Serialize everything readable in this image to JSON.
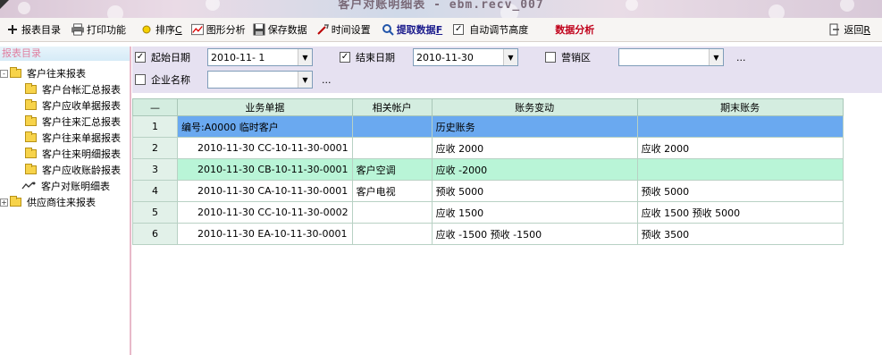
{
  "window": {
    "title": "客户对账明细表 - ebm.recv_007"
  },
  "toolbar": {
    "items": [
      {
        "label": "报表目录",
        "icon": "plus-icon"
      },
      {
        "label": "打印功能",
        "icon": "printer-icon"
      },
      {
        "label": "排序",
        "hotkey": "C",
        "icon": "sort-icon"
      },
      {
        "label": "图形分析",
        "icon": "chart-icon"
      },
      {
        "label": "保存数据",
        "icon": "save-icon"
      },
      {
        "label": "时间设置",
        "icon": "clock-icon"
      },
      {
        "label": "提取数据",
        "hotkey": "F",
        "icon": "fetch-icon"
      },
      {
        "label": "自动调节高度",
        "checked": true
      },
      {
        "label": "数据分析"
      },
      {
        "label": "返回",
        "hotkey": "R",
        "icon": "return-icon"
      }
    ]
  },
  "sidebar": {
    "header": "报表目录",
    "tree": [
      {
        "label": "客户往来报表",
        "expander": "-"
      },
      {
        "label": "客户台帐汇总报表"
      },
      {
        "label": "客户应收单据报表"
      },
      {
        "label": "客户往来汇总报表"
      },
      {
        "label": "客户往来单据报表"
      },
      {
        "label": "客户往来明细报表"
      },
      {
        "label": "客户应收账龄报表"
      },
      {
        "label": "客户对账明细表"
      },
      {
        "label": "供应商往来报表",
        "expander": "+"
      }
    ]
  },
  "filter": {
    "start_label": "起始日期",
    "start_value": "2010-11-  1",
    "start_checked": true,
    "end_label": "结束日期",
    "end_value": "2010-11-30",
    "end_checked": true,
    "region_label": "营销区",
    "region_value": "",
    "region_checked": false,
    "company_label": "企业名称",
    "company_value": "",
    "company_checked": false,
    "more": "..."
  },
  "table": {
    "corner": "—",
    "headers": [
      "业务单据",
      "相关帐户",
      "账务变动",
      "期末账务"
    ],
    "rows": [
      {
        "idx": "1",
        "doc": "编号:A0000  临时客户",
        "account": "",
        "change": "历史账务",
        "ending": ""
      },
      {
        "idx": "2",
        "doc": "2010-11-30 CC-10-11-30-0001",
        "account": "",
        "change": "应收 2000",
        "ending": "应收 2000"
      },
      {
        "idx": "3",
        "doc": "2010-11-30 CB-10-11-30-0001",
        "account": "客户空调",
        "change": "应收 -2000",
        "ending": ""
      },
      {
        "idx": "4",
        "doc": "2010-11-30 CA-10-11-30-0001",
        "account": "客户电视",
        "change": "预收 5000",
        "ending": "预收 5000"
      },
      {
        "idx": "5",
        "doc": "2010-11-30 CC-10-11-30-0002",
        "account": "",
        "change": "应收 1500",
        "ending": "应收 1500  预收 5000"
      },
      {
        "idx": "6",
        "doc": "2010-11-30 EA-10-11-30-0001",
        "account": "",
        "change": "应收 -1500  预收 -1500",
        "ending": "预收 3500"
      }
    ]
  },
  "colors": {
    "selected_row": "#6aa9f0",
    "alt_row": "#b9f5d7",
    "filter_bg": "#e6e1f1",
    "accent_red": "#c0001a"
  }
}
